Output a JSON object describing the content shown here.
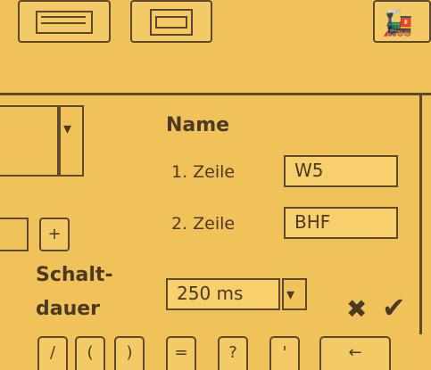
{
  "toolbar": {
    "icons": [
      "keyboard-icon",
      "monitor-icon",
      "locomotive-icon"
    ]
  },
  "dropdown": {
    "value": "",
    "arrow": "▾"
  },
  "plus_button": {
    "label": "+"
  },
  "name_section": {
    "title": "Name",
    "line1_label": "1. Zeile",
    "line1_value": "W5",
    "line2_label": "2. Zeile",
    "line2_value": "BHF"
  },
  "switch_duration": {
    "label_line1": "Schalt-",
    "label_line2": "dauer",
    "value": "250 ms",
    "arrow": "▾"
  },
  "actions": {
    "cancel": "✖",
    "confirm": "✔"
  },
  "keyboard": {
    "keys": [
      "/",
      "(",
      ")",
      "=",
      "?",
      "'",
      "←"
    ]
  }
}
